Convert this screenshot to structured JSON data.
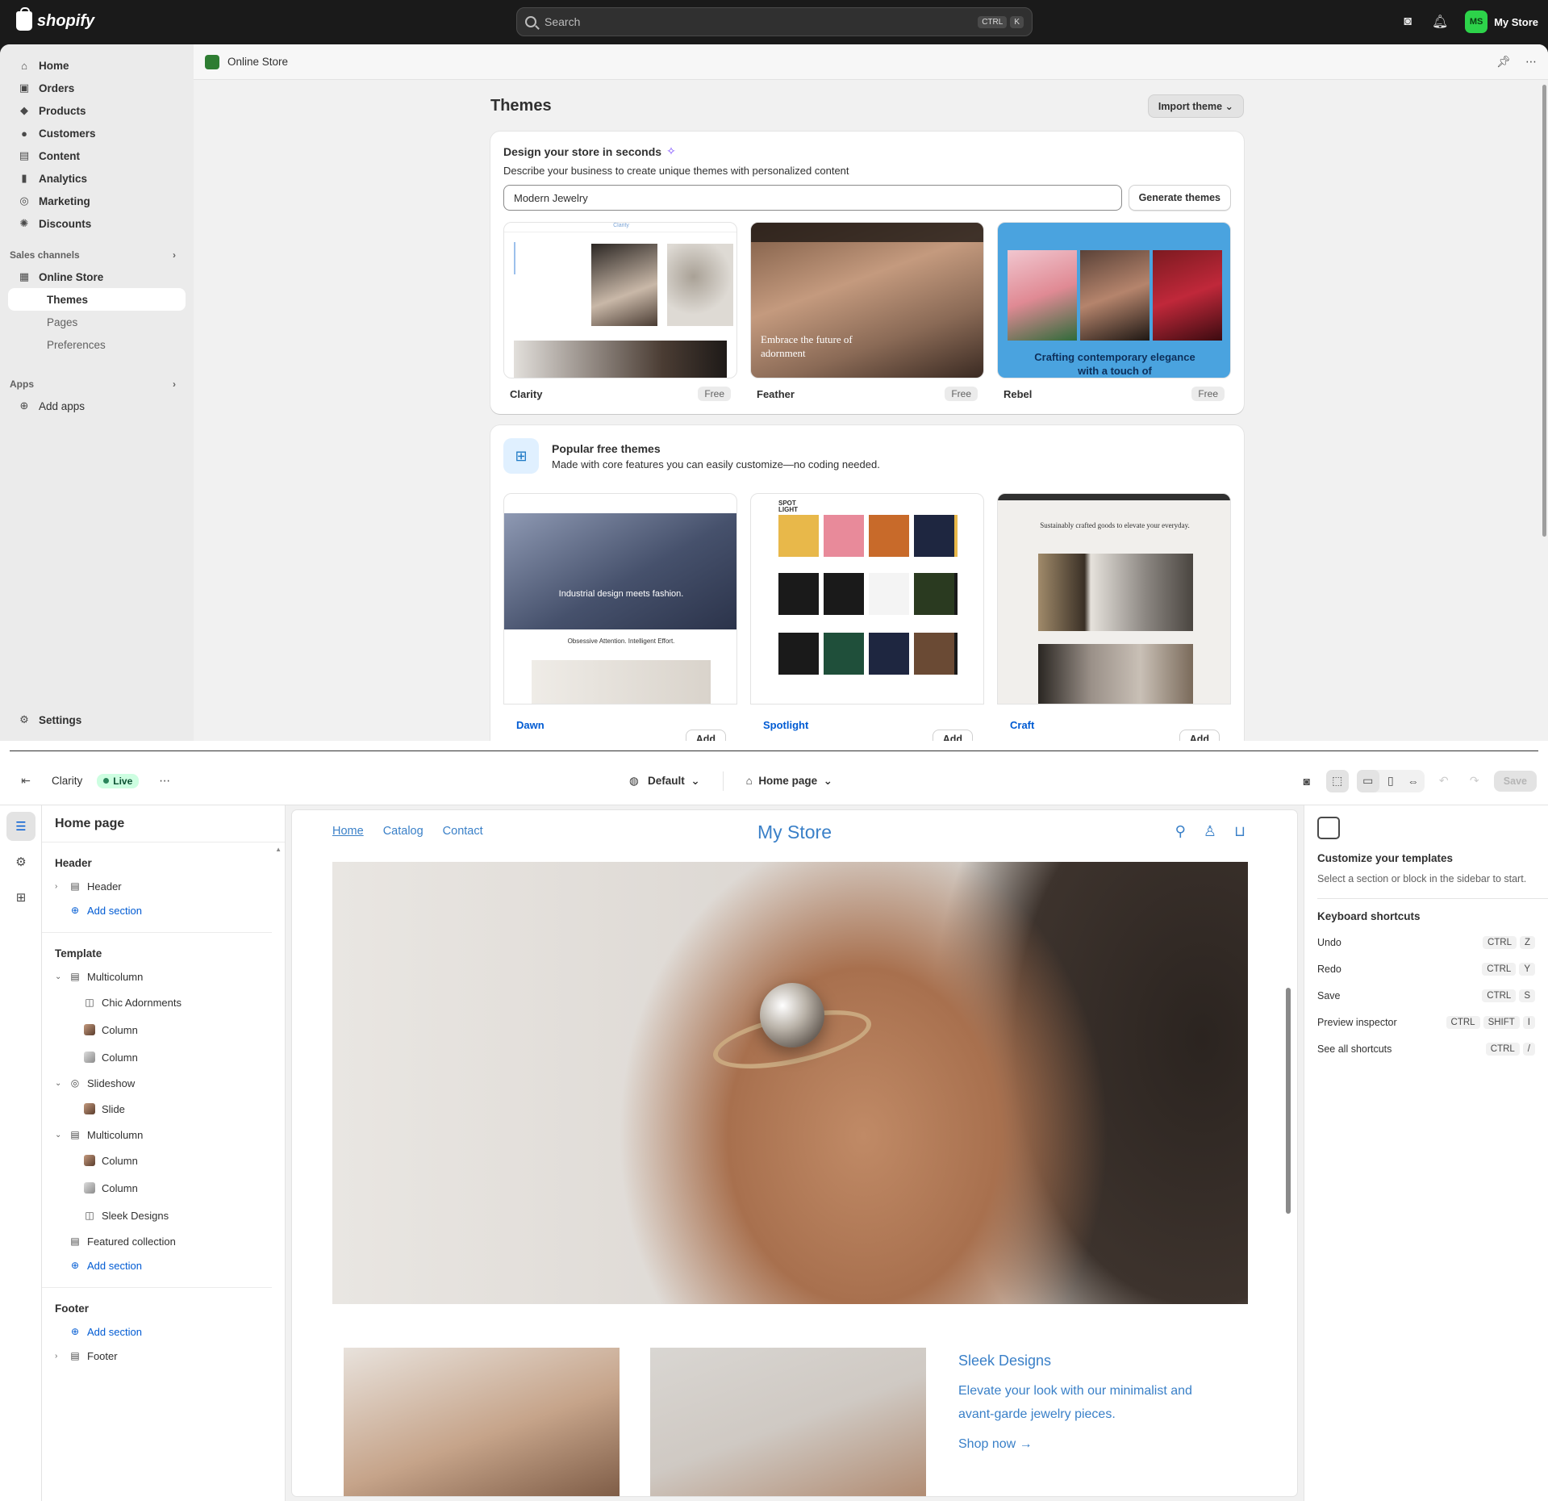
{
  "topbar": {
    "brand": "shopify",
    "search_placeholder": "Search",
    "search_keys": [
      "CTRL",
      "K"
    ],
    "avatar_initials": "MS",
    "store_name": "My Store"
  },
  "nav": {
    "items": [
      {
        "label": "Home",
        "icon": "home-icon"
      },
      {
        "label": "Orders",
        "icon": "inbox-icon"
      },
      {
        "label": "Products",
        "icon": "tag-icon"
      },
      {
        "label": "Customers",
        "icon": "person-icon"
      },
      {
        "label": "Content",
        "icon": "content-icon"
      },
      {
        "label": "Analytics",
        "icon": "bar-chart-icon"
      },
      {
        "label": "Marketing",
        "icon": "target-icon"
      },
      {
        "label": "Discounts",
        "icon": "discount-icon"
      }
    ],
    "sales_channels": "Sales channels",
    "online_store": "Online Store",
    "sub": [
      "Themes",
      "Pages",
      "Preferences"
    ],
    "apps": "Apps",
    "add_apps": "Add apps",
    "settings": "Settings"
  },
  "admin": {
    "breadcrumb": "Online Store",
    "title": "Themes",
    "import_button": "Import theme",
    "design": {
      "title": "Design your store in seconds",
      "subtitle": "Describe your business to create unique themes with personalized content",
      "input_value": "Modern Jewelry",
      "generate_button": "Generate themes"
    },
    "generated_themes": [
      {
        "name": "Clarity",
        "badge": "Free",
        "thumb_text": "Clarity"
      },
      {
        "name": "Feather",
        "badge": "Free",
        "thumb_text": "Embrace the future of adornment"
      },
      {
        "name": "Rebel",
        "badge": "Free",
        "thumb_text": "Crafting contemporary elegance with a touch of"
      }
    ],
    "popular": {
      "title": "Popular free themes",
      "subtitle": "Made with core features you can easily customize—no coding needed.",
      "themes": [
        {
          "name": "Dawn",
          "add": "Add",
          "thumb_text": "Industrial design meets fashion.",
          "thumb_sub": "Obsessive Attention. Intelligent Effort."
        },
        {
          "name": "Spotlight",
          "add": "Add",
          "thumb_text": "SPOT LIGHT"
        },
        {
          "name": "Craft",
          "add": "Add",
          "thumb_text": "Sustainably crafted goods to elevate your everyday."
        }
      ]
    }
  },
  "editor": {
    "theme_name": "Clarity",
    "live_label": "Live",
    "preset": "Default",
    "page": "Home page",
    "save": "Save",
    "sidebar": {
      "title": "Home page",
      "header_group": "Header",
      "header_item": "Header",
      "add_section": "Add section",
      "template_group": "Template",
      "template_items": [
        {
          "label": "Multicolumn",
          "level": 1,
          "icon": "multicolumn-icon"
        },
        {
          "label": "Chic Adornments",
          "level": 2,
          "icon": "text-block-icon"
        },
        {
          "label": "Column",
          "level": 2,
          "icon": "image-thumb-icon"
        },
        {
          "label": "Column",
          "level": 2,
          "icon": "image-thumb-icon"
        },
        {
          "label": "Slideshow",
          "level": 1,
          "icon": "slideshow-icon"
        },
        {
          "label": "Slide",
          "level": 2,
          "icon": "image-thumb-icon"
        },
        {
          "label": "Multicolumn",
          "level": 1,
          "icon": "multicolumn-icon"
        },
        {
          "label": "Column",
          "level": 2,
          "icon": "image-thumb-icon"
        },
        {
          "label": "Column",
          "level": 2,
          "icon": "image-thumb-icon"
        },
        {
          "label": "Sleek Designs",
          "level": 2,
          "icon": "text-block-icon"
        },
        {
          "label": "Featured collection",
          "level": 0,
          "icon": "collection-icon"
        }
      ],
      "footer_group": "Footer",
      "footer_item": "Footer"
    },
    "store": {
      "nav": [
        "Home",
        "Catalog",
        "Contact"
      ],
      "logo": "My Store",
      "sleek_title": "Sleek Designs",
      "sleek_text": "Elevate your look with our minimalist and avant-garde jewelry pieces.",
      "shop_now": "Shop now →"
    },
    "inspector": {
      "title": "Customize your templates",
      "subtitle": "Select a section or block in the sidebar to start.",
      "shortcuts_title": "Keyboard shortcuts",
      "shortcuts": [
        {
          "label": "Undo",
          "keys": [
            "CTRL",
            "Z"
          ]
        },
        {
          "label": "Redo",
          "keys": [
            "CTRL",
            "Y"
          ]
        },
        {
          "label": "Save",
          "keys": [
            "CTRL",
            "S"
          ]
        },
        {
          "label": "Preview inspector",
          "keys": [
            "CTRL",
            "SHIFT",
            "I"
          ]
        },
        {
          "label": "See all shortcuts",
          "keys": [
            "CTRL",
            "/"
          ]
        }
      ]
    }
  },
  "colors": {
    "topbar": "#1a1a1a",
    "accent_green": "#2dd34a",
    "link_blue": "#005bd3",
    "store_blue": "#3a80c8",
    "live_bg": "#cdfee1"
  }
}
